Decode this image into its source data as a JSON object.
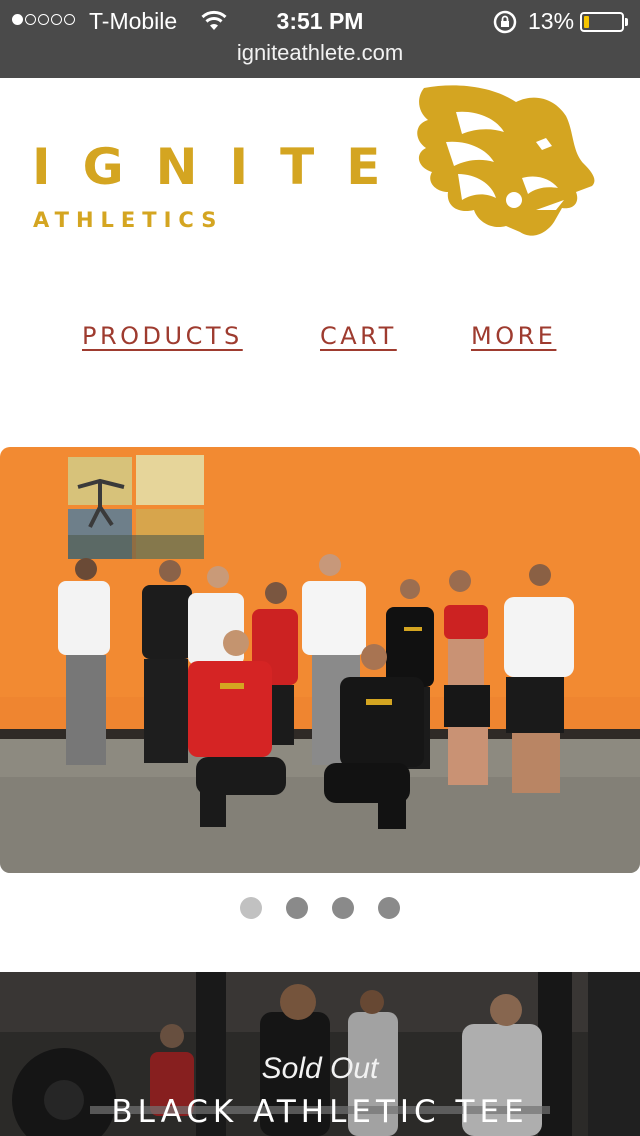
{
  "status_bar": {
    "carrier": "T-Mobile",
    "time": "3:51 PM",
    "battery_percent": "13%",
    "battery_level": 0.13,
    "signal_strength": 1,
    "url": "igniteathlete.com"
  },
  "logo": {
    "wordmark": "IGNITE",
    "subtitle": "ATHLETICS",
    "color": "#d4a521",
    "icon": "lion-head-icon"
  },
  "nav": {
    "items": [
      {
        "label": "PRODUCTS"
      },
      {
        "label": "CART"
      },
      {
        "label": "MORE"
      }
    ],
    "link_color": "#9e3b2f"
  },
  "carousel": {
    "slide_count": 4,
    "active_index": 0
  },
  "featured_product": {
    "status": "Sold Out",
    "title": "BLACK ATHLETIC TEE"
  }
}
